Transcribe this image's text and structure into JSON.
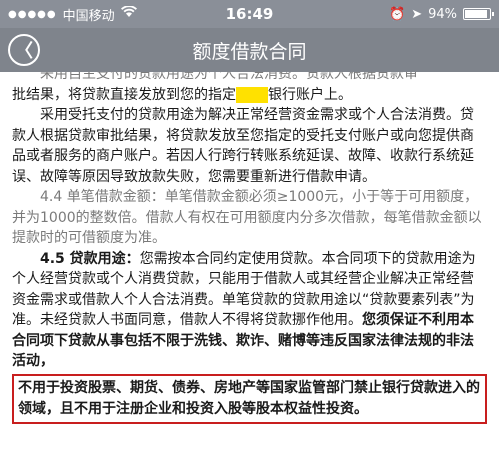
{
  "status_bar": {
    "carrier": "中国移动",
    "wifi_icon": "wifi-icon",
    "time": "16:49",
    "battery_percent_label": "94%",
    "battery_level": 0.94
  },
  "nav": {
    "back_icon": "chevron-left-icon",
    "title": "额度借款合同"
  },
  "content": {
    "p0": "采用自主支付的贷款用途为个人合法消费。贷款人根据贷款审",
    "p1a": "批结果，将贷款直接发放到您的指定",
    "p1b": "银行账户上。",
    "p2": "采用受托支付的贷款用途为解决正常经营资金需求或个人合法消费。贷款人根据贷款审批结果，将贷款发放至您指定的受托支付账户或向您提供商品或者服务的商户账户。若因人行跨行转账系统延误、故障、收款行系统延误、故障等原因导致放款失败，您需要重新进行借款申请。",
    "p3": "4.4 单笔借款金额：单笔借款金额必须≥1000元，小于等于可用额度，并为1000的整数倍。借款人有权在可用额度内分多次借款，每笔借款金额以提款时的可借额度为准。",
    "p4_label": "4.5 贷款用途：",
    "p4": "您需按本合同约定使用贷款。本合同项下的贷款用途为个人经营贷款或个人消费贷款，只能用于借款人或其经营企业解决正常经营资金需求或借款人个人合法消费。单笔贷款的贷款用途以“贷款要素列表”为准。未经贷款人书面同意，借款人不得将贷款挪作他用。",
    "p4_bold": "您须保证不利用本合同项下贷款从事包括不限于洗钱、欺诈、赌博等违反国家法律法规的非法活动，",
    "red_box": "不用于投资股票、期货、债券、房地产等国家监管部门禁止银行贷款进入的领域，且不用于注册企业和投资入股等股本权益性投资。"
  }
}
